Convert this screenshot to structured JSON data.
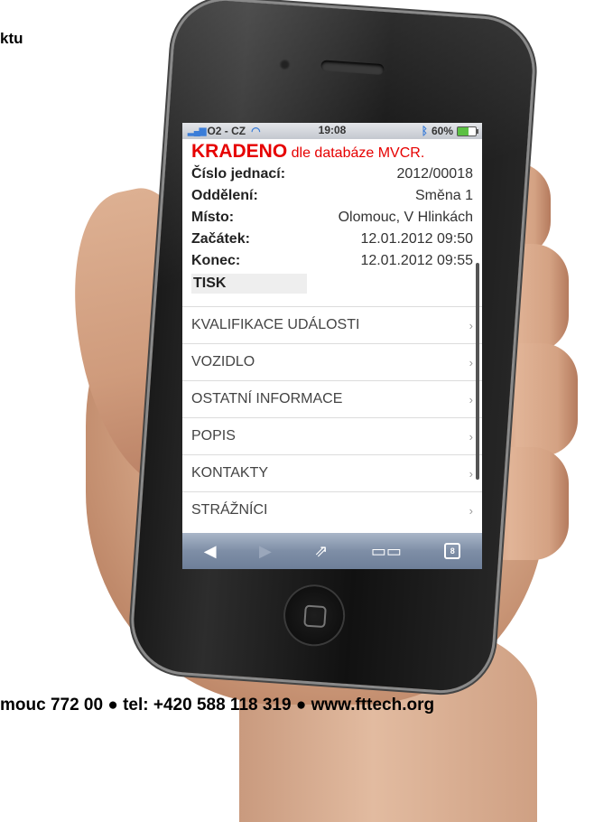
{
  "page": {
    "top_text": "ktu",
    "footer_text": "mouc 772 00 ● tel: +420 588 118 319 ● www.fttech.org"
  },
  "statusbar": {
    "carrier": "O2 - CZ",
    "time": "19:08",
    "battery": "60%"
  },
  "header": {
    "title_strong": "KRADENO",
    "title_rest": "dle databáze MVCR."
  },
  "details": [
    {
      "label": "Číslo jednací:",
      "value": "2012/00018"
    },
    {
      "label": "Oddělení:",
      "value": "Směna 1"
    },
    {
      "label": "Místo:",
      "value": "Olomouc, V Hlinkách"
    },
    {
      "label": "Začátek:",
      "value": "12.01.2012 09:50"
    },
    {
      "label": "Konec:",
      "value": "12.01.2012 09:55"
    }
  ],
  "tisk_label": "TISK",
  "menu": [
    {
      "label": "KVALIFIKACE UDÁLOSTI"
    },
    {
      "label": "VOZIDLO"
    },
    {
      "label": "OSTATNÍ INFORMACE"
    },
    {
      "label": "POPIS"
    },
    {
      "label": "KONTAKTY"
    },
    {
      "label": "STRÁŽNÍCI"
    }
  ],
  "toolbar": {
    "tabs_count": "8"
  },
  "colors": {
    "accent_red": "#e60000",
    "toolbar_blue": "#7e8ea6"
  },
  "icons": {
    "back": "back-arrow-icon",
    "forward": "forward-arrow-icon",
    "share": "share-icon",
    "bookmarks": "bookmarks-icon",
    "tabs": "tabs-icon"
  }
}
